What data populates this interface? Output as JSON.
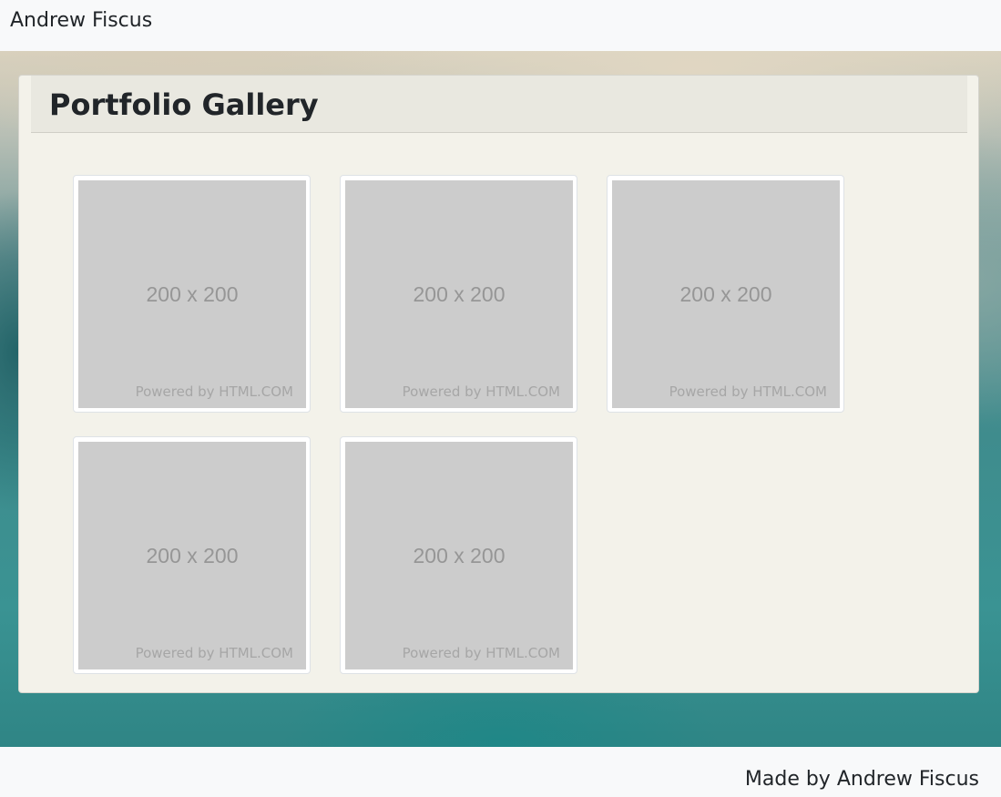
{
  "navbar": {
    "brand": "Andrew Fiscus"
  },
  "gallery": {
    "title": "Portfolio Gallery",
    "items": [
      {
        "size_label": "200 x 200",
        "powered_label": "Powered by HTML.COM"
      },
      {
        "size_label": "200 x 200",
        "powered_label": "Powered by HTML.COM"
      },
      {
        "size_label": "200 x 200",
        "powered_label": "Powered by HTML.COM"
      },
      {
        "size_label": "200 x 200",
        "powered_label": "Powered by HTML.COM"
      },
      {
        "size_label": "200 x 200",
        "powered_label": "Powered by HTML.COM"
      }
    ]
  },
  "footer": {
    "text": "Made by Andrew Fiscus"
  }
}
